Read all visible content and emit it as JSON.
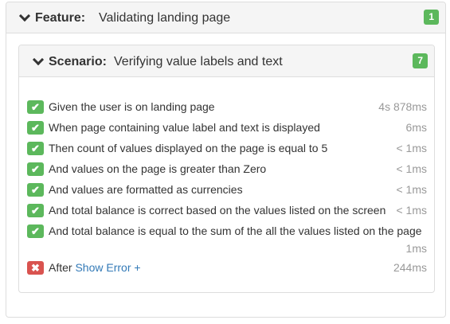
{
  "feature": {
    "keyword": "Feature:",
    "name": "Validating landing page",
    "count": "1"
  },
  "scenario": {
    "keyword": "Scenario:",
    "name": "Verifying value labels and text",
    "count": "7",
    "steps": [
      {
        "status": "passed",
        "icon": "checkmark-icon",
        "text": "Given the user is on landing page",
        "duration": "4s 878ms"
      },
      {
        "status": "passed",
        "icon": "checkmark-icon",
        "text": "When page containing value label and text is displayed",
        "duration": "6ms"
      },
      {
        "status": "passed",
        "icon": "checkmark-icon",
        "text": "Then count of values displayed on the page is equal to 5",
        "duration": "< 1ms"
      },
      {
        "status": "passed",
        "icon": "checkmark-icon",
        "text": "And values on the page is greater than Zero",
        "duration": "< 1ms"
      },
      {
        "status": "passed",
        "icon": "checkmark-icon",
        "text": "And values are formatted as currencies",
        "duration": "< 1ms"
      },
      {
        "status": "passed",
        "icon": "checkmark-icon",
        "text": "And total balance is correct based on the values listed on the screen",
        "duration": "< 1ms"
      },
      {
        "status": "passed",
        "icon": "checkmark-icon",
        "text": "And total balance is equal to the sum of the all the values listed on the page",
        "duration": "1ms"
      },
      {
        "status": "failed",
        "icon": "cross-icon",
        "text": "After",
        "link": "Show Error +",
        "duration": "244ms"
      }
    ]
  },
  "colors": {
    "passed": "#5cb85c",
    "failed": "#d9534f",
    "link": "#337ab7",
    "muted": "#999999"
  }
}
